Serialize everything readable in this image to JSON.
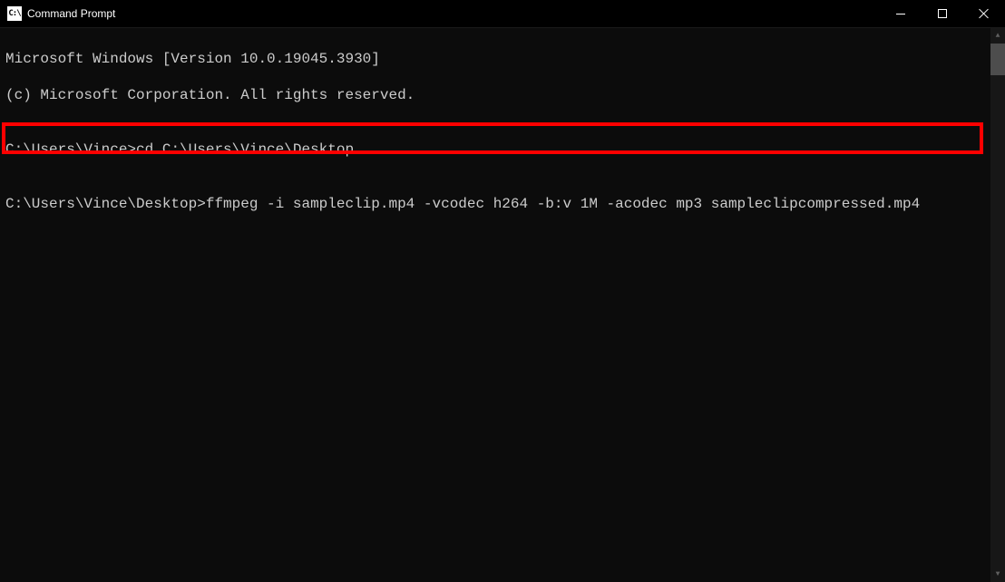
{
  "titlebar": {
    "icon_text": "C:\\",
    "title": "Command Prompt"
  },
  "terminal": {
    "line1": "Microsoft Windows [Version 10.0.19045.3930]",
    "line2": "(c) Microsoft Corporation. All rights reserved.",
    "blank1": "",
    "prompt1": "C:\\Users\\Vince>",
    "command1": "cd C:\\Users\\Vince\\Desktop",
    "blank2": "",
    "prompt2": "C:\\Users\\Vince\\Desktop>",
    "command2": "ffmpeg -i sampleclip.mp4 -vcodec h264 -b:v 1M -acodec mp3 sampleclipcompressed.mp4"
  }
}
